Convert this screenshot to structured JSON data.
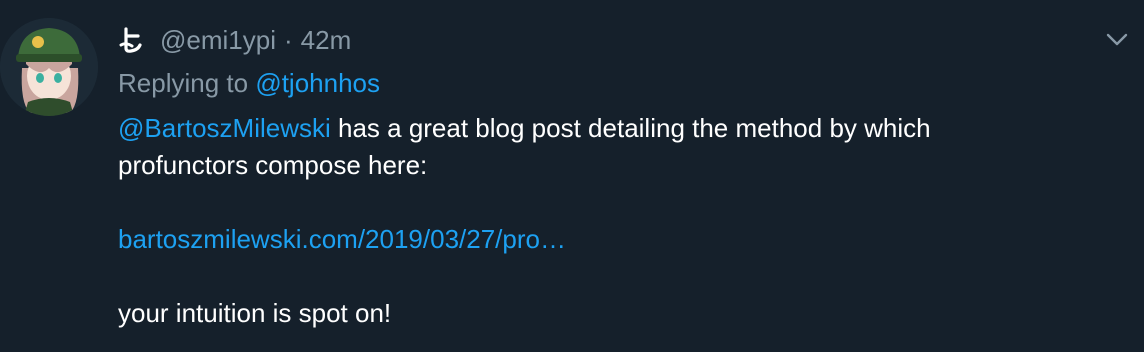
{
  "tweet": {
    "display_name_glyph": "よ",
    "handle": "@emi1ypi",
    "separator": "·",
    "time": "42m",
    "reply_prefix": "Replying to",
    "reply_to": "@tjohnhos",
    "mention": "@BartoszMilewski",
    "text_line1_rest": " has a great blog post detailing the method by which",
    "text_line2": "profunctors compose here:",
    "url_text": "bartoszmilewski.com/2019/03/27/pro…",
    "closing_text": "your intuition is spot on!"
  },
  "colors": {
    "background": "#15202b",
    "text": "#ffffff",
    "muted": "#8899a6",
    "link": "#1da1f2"
  },
  "icons": {
    "avatar": "avatar-anime-character",
    "menu": "chevron-down-icon"
  }
}
